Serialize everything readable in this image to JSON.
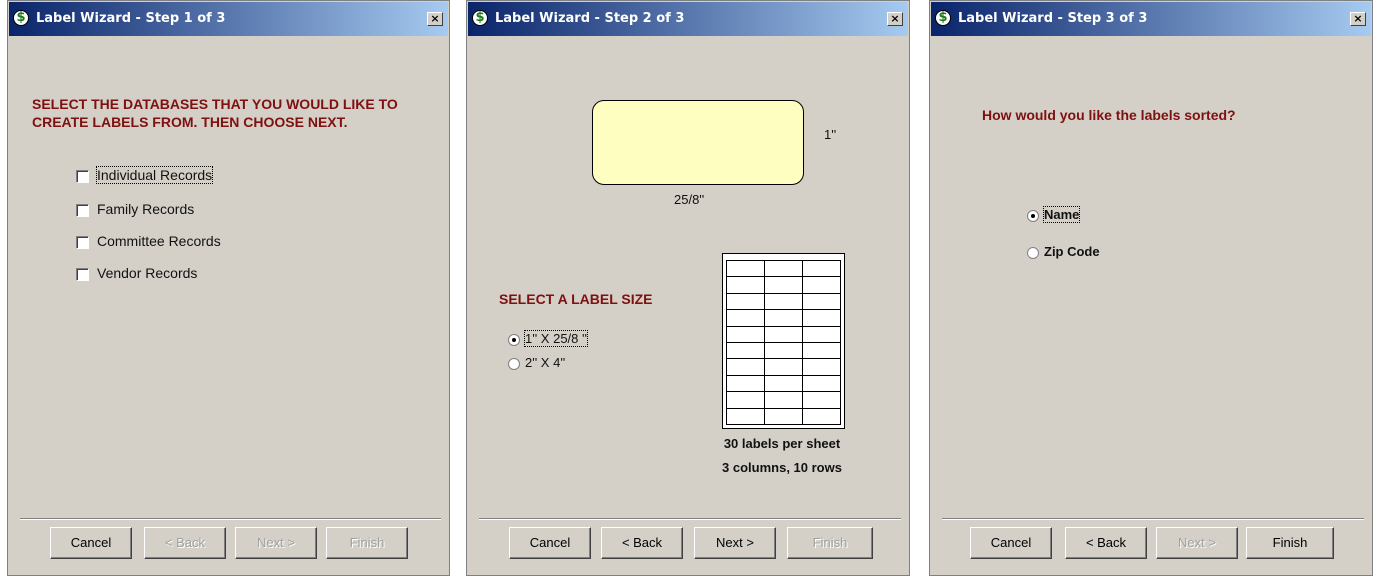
{
  "dialogs": [
    {
      "title": "Label Wizard - Step 1 of 3",
      "close": "×",
      "heading": "SELECT THE DATABASES THAT YOU WOULD LIKE TO CREATE LABELS FROM. THEN CHOOSE NEXT.",
      "checkboxes": [
        "Individual Records",
        "Family Records",
        "Committee Records",
        "Vendor Records"
      ],
      "buttons": {
        "cancel": "Cancel",
        "back": "< Back",
        "next": "Next >",
        "finish": "Finish"
      }
    },
    {
      "title": "Label Wizard - Step 2 of 3",
      "close": "×",
      "height_dim": "1''",
      "width_dim": "25/8''",
      "heading": "SELECT A LABEL SIZE",
      "options": [
        "1'' X 25/8 ''",
        "2'' X 4''"
      ],
      "selected_option": "1'' X 25/8 ''",
      "sheet_info": [
        "30 labels per sheet",
        "3 columns, 10 rows"
      ],
      "buttons": {
        "cancel": "Cancel",
        "back": "< Back",
        "next": "Next >",
        "finish": "Finish"
      }
    },
    {
      "title": "Label Wizard - Step 3 of 3",
      "close": "×",
      "heading": "How would you like the labels sorted?",
      "options": [
        "Name",
        "Zip Code"
      ],
      "selected_option": "Name",
      "buttons": {
        "cancel": "Cancel",
        "back": "< Back",
        "next": "Next >",
        "finish": "Finish"
      }
    }
  ],
  "colors": {
    "title_bar_start": "#0a246a",
    "title_bar_end": "#a6caf0",
    "heading": "#7f1010",
    "label_fill": "#fffec1",
    "dialog_bg": "#d4d0c8"
  }
}
